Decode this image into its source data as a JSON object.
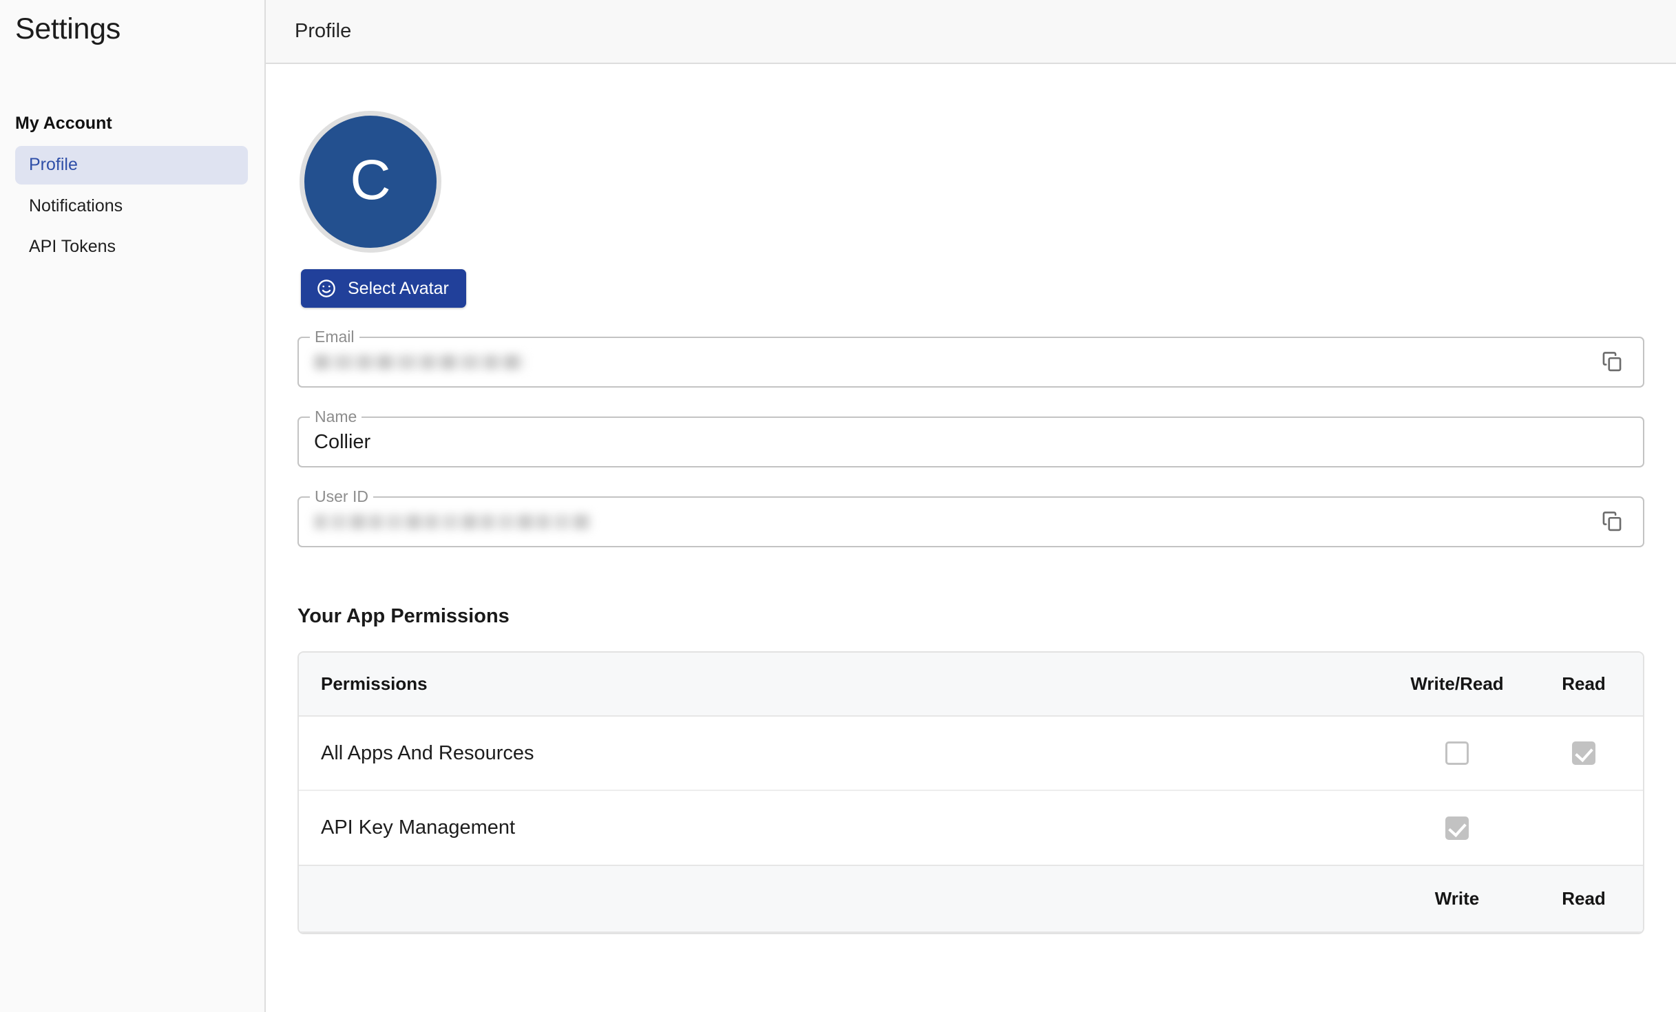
{
  "sidebar": {
    "title": "Settings",
    "group_title": "My Account",
    "items": [
      {
        "label": "Profile",
        "active": true
      },
      {
        "label": "Notifications",
        "active": false
      },
      {
        "label": "API Tokens",
        "active": false
      }
    ]
  },
  "topbar": {
    "title": "Profile"
  },
  "profile": {
    "avatar": {
      "initial": "C",
      "bg_color": "#23508f",
      "ring_color": "#dfdfdf",
      "text_color": "#ffffff"
    },
    "select_avatar_button": {
      "label": "Select Avatar",
      "icon": "smiley-face-icon",
      "bg_color": "#21409a",
      "text_color": "#ffffff"
    },
    "fields": [
      {
        "label": "Email",
        "value": "",
        "redacted": true,
        "readonly": true,
        "has_copy_button": true,
        "copy_icon": "copy-icon"
      },
      {
        "label": "Name",
        "value": "Collier",
        "redacted": false,
        "readonly": false,
        "has_copy_button": false,
        "copy_icon": ""
      },
      {
        "label": "User ID",
        "value": "",
        "redacted": true,
        "readonly": true,
        "has_copy_button": true,
        "copy_icon": "copy-icon"
      }
    ]
  },
  "permissions": {
    "heading": "Your App Permissions",
    "columns": [
      "Permissions",
      "Write/Read",
      "Read"
    ],
    "rows": [
      {
        "name": "All Apps And Resources",
        "col_a": "unchecked",
        "col_b": "checked"
      },
      {
        "name": "API Key Management",
        "col_a": "checked",
        "col_b": "empty"
      }
    ],
    "footer_columns": [
      "",
      "Write",
      "Read"
    ]
  },
  "colors": {
    "accent_blue": "#21409a",
    "active_nav_bg": "#dfe3f1",
    "active_nav_text": "#2f4fa8",
    "checkbox_gray": "#c2c2c2",
    "panel_bg": "#fafafa",
    "header_bg": "#f7f8f9"
  }
}
